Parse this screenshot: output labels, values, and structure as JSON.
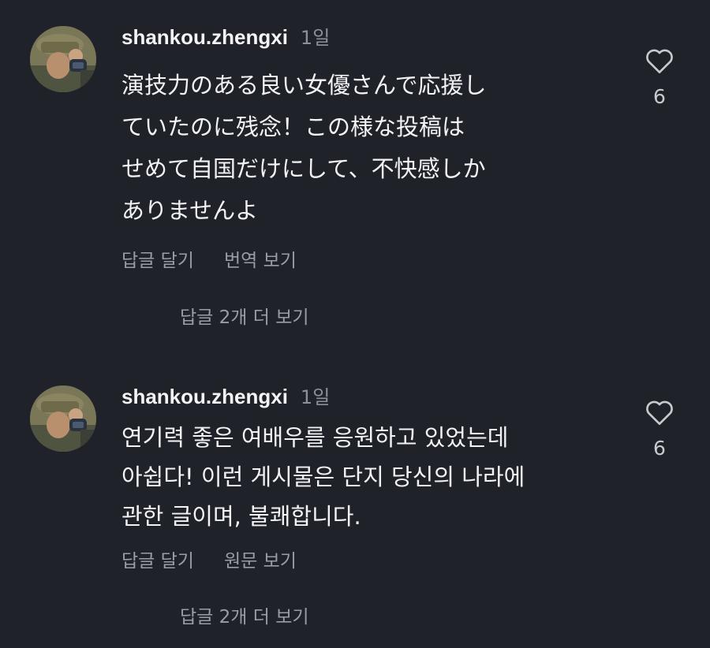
{
  "comments": [
    {
      "username": "shankou.zhengxi",
      "time": "1일",
      "text": "演技力のある良い女優さんで応援し\nていたのに残念！この様な投稿は\nせめて自国だけにして、不快感しか\nありませんよ",
      "reply_label": "답글 달기",
      "translate_label": "번역 보기",
      "likes": "6",
      "more_replies": "답글 2개 더 보기"
    },
    {
      "username": "shankou.zhengxi",
      "time": "1일",
      "text": "연기력 좋은 여배우를 응원하고 있었는데\n아쉽다! 이런 게시물은 단지 당신의 나라에\n관한 글이며, 불쾌합니다.",
      "reply_label": "답글 달기",
      "translate_label": "원문 보기",
      "likes": "6",
      "more_replies": "답글 2개 더 보기"
    }
  ],
  "icons": {
    "like": "heart-outline-icon"
  },
  "colors": {
    "background": "#20222a",
    "primary_text": "#f3f3f5",
    "secondary_text": "#9b9da5"
  }
}
